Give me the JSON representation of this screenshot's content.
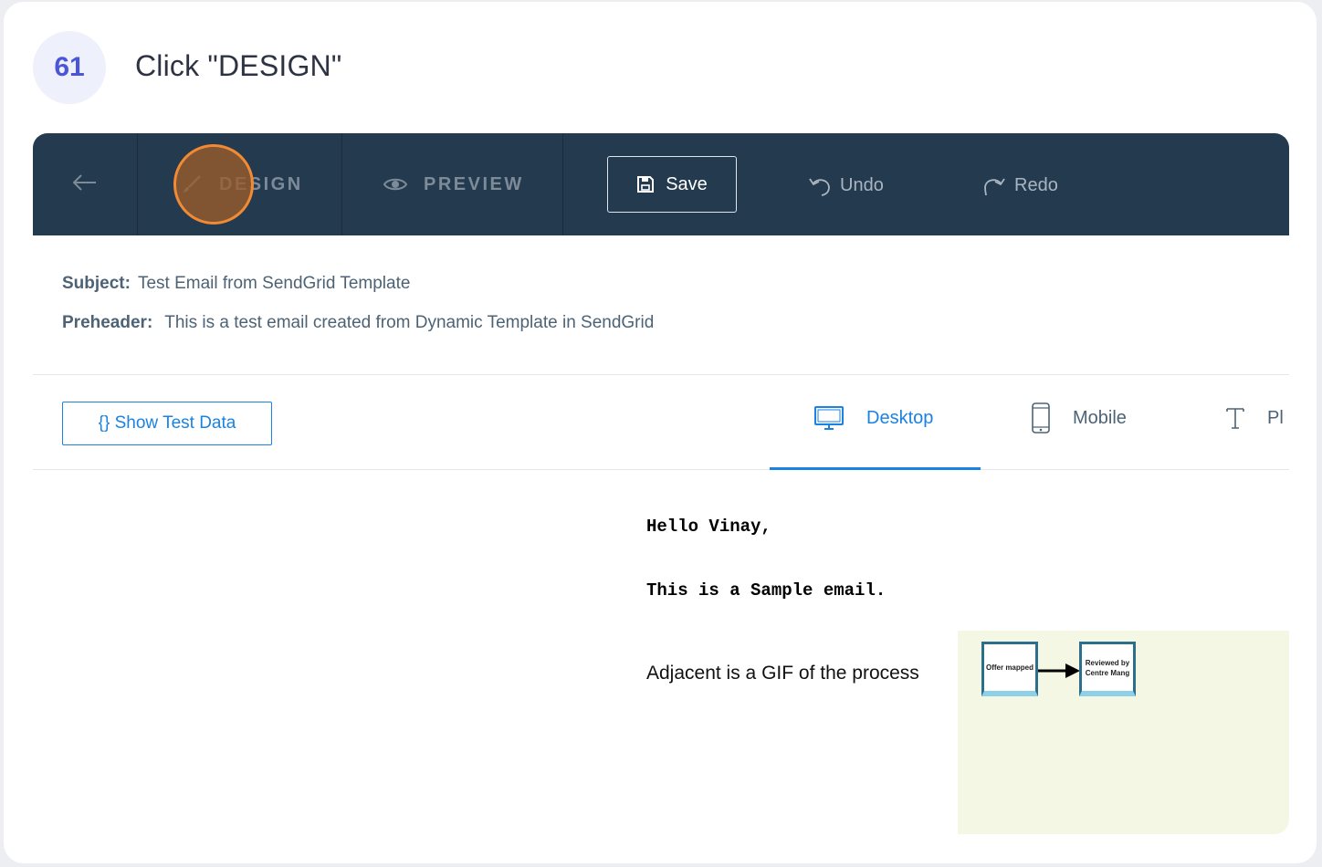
{
  "step": {
    "number": "61",
    "instruction": "Click \"DESIGN\""
  },
  "toolbar": {
    "design_label": "DESIGN",
    "preview_label": "PREVIEW",
    "save_label": "Save",
    "undo_label": "Undo",
    "redo_label": "Redo"
  },
  "meta": {
    "subject_label": "Subject:",
    "subject_value": "Test Email from SendGrid Template",
    "preheader_label": "Preheader:",
    "preheader_value": "This is a test email created from Dynamic Template in SendGrid"
  },
  "controls": {
    "show_test_data_label": "{} Show Test Data",
    "view_tabs": [
      {
        "label": "Desktop",
        "icon": "desktop-icon",
        "active": true
      },
      {
        "label": "Mobile",
        "icon": "mobile-icon",
        "active": false
      },
      {
        "label": "Pl",
        "icon": "plain-text-icon",
        "active": false
      }
    ]
  },
  "email": {
    "greeting": "Hello Vinay,",
    "line1": "This is a Sample email.",
    "body": "Adjacent is a GIF of the process",
    "gif": {
      "box1": "Offer mapped",
      "box2": "Reviewed by Centre Mang"
    }
  },
  "colors": {
    "toolbar_bg": "#243a4f",
    "accent": "#1a82e2",
    "highlight": "#f08a35",
    "step_badge_text": "#4a56d6"
  }
}
